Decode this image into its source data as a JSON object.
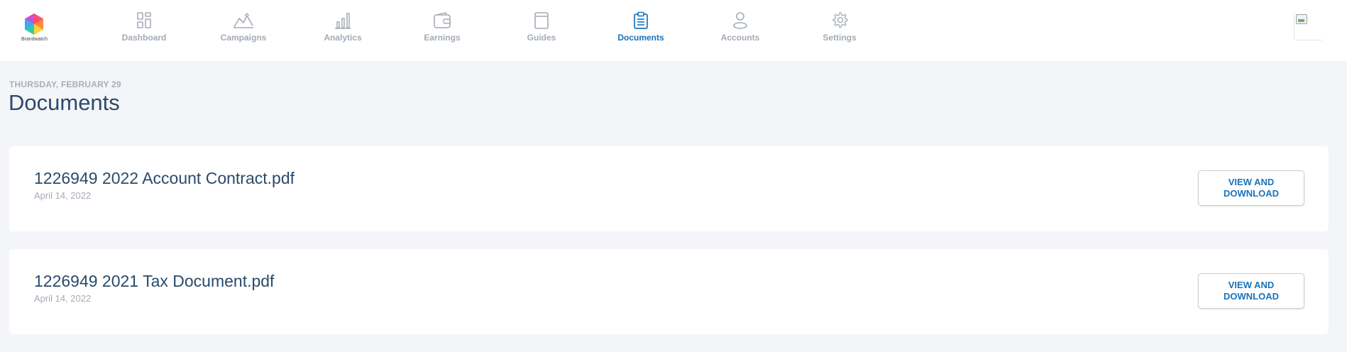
{
  "brand": {
    "logo_text": "Brandwatch"
  },
  "nav": {
    "items": [
      {
        "label": "Dashboard",
        "icon": "dashboard-icon",
        "active": false
      },
      {
        "label": "Campaigns",
        "icon": "campaigns-icon",
        "active": false
      },
      {
        "label": "Analytics",
        "icon": "analytics-icon",
        "active": false
      },
      {
        "label": "Earnings",
        "icon": "wallet-icon",
        "active": false
      },
      {
        "label": "Guides",
        "icon": "book-icon",
        "active": false
      },
      {
        "label": "Documents",
        "icon": "clipboard-icon",
        "active": true
      },
      {
        "label": "Accounts",
        "icon": "user-icon",
        "active": false
      },
      {
        "label": "Settings",
        "icon": "gear-icon",
        "active": false
      }
    ]
  },
  "page": {
    "date": "THURSDAY, FEBRUARY 29",
    "title": "Documents"
  },
  "documents": [
    {
      "name": "1226949 2022 Account Contract.pdf",
      "date": "April 14, 2022",
      "button_label": "VIEW AND DOWNLOAD"
    },
    {
      "name": "1226949 2021 Tax Document.pdf",
      "date": "April 14, 2022",
      "button_label": "VIEW AND DOWNLOAD"
    }
  ],
  "colors": {
    "accent": "#1a73b9",
    "text_primary": "#2a4a6b",
    "text_muted": "#a3abb6",
    "background": "#f4f5f8"
  }
}
